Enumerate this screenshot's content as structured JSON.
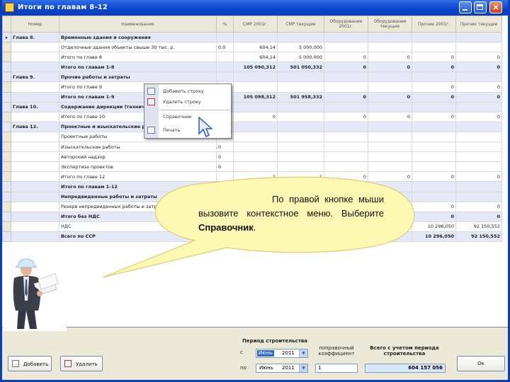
{
  "window": {
    "title": "Итоги по главам 8-12"
  },
  "table": {
    "columns": [
      "Номер",
      "Наименование",
      "%",
      "СМР 2001г.",
      "СМР текущие",
      "Оборудование 2001г.",
      "Оборудование текущие",
      "Прочие 2001г.",
      "Прочие текущие"
    ],
    "rows": [
      {
        "marker": "▸",
        "num": "Глава 8.",
        "name": "Временные здания и сооружения",
        "pct": "",
        "smr2001": "",
        "smrcur": "",
        "eq2001": "",
        "eqcur": "",
        "oth2001": "",
        "othcur": "",
        "style": "blue-bold"
      },
      {
        "marker": "",
        "num": "",
        "name": "Отделочные здания объекты свыше 30 тыс. р.",
        "pct": "0,0",
        "smr2001": "604,14",
        "smrcur": "5 000,000",
        "eq2001": "",
        "eqcur": "",
        "oth2001": "",
        "othcur": "",
        "style": ""
      },
      {
        "marker": "",
        "num": "",
        "name": "Итого по главе 8",
        "pct": "",
        "smr2001": "604,14",
        "smrcur": "5 000,000",
        "eq2001": "0",
        "eqcur": "0",
        "oth2001": "0",
        "othcur": "0",
        "style": ""
      },
      {
        "marker": "",
        "num": "",
        "name": "Итого по главам 1-8",
        "pct": "",
        "smr2001": "105 090,312",
        "smrcur": "501 050,332",
        "eq2001": "0",
        "eqcur": "0",
        "oth2001": "0",
        "othcur": "0",
        "style": "blue-bold"
      },
      {
        "marker": "",
        "num": "Глава 9.",
        "name": "Прочие работы и затраты",
        "pct": "",
        "smr2001": "",
        "smrcur": "",
        "eq2001": "",
        "eqcur": "",
        "oth2001": "",
        "othcur": "",
        "style": "blue-bold"
      },
      {
        "marker": "",
        "num": "",
        "name": "Итого по главе 9",
        "pct": "",
        "smr2001": "",
        "smrcur": "",
        "eq2001": "",
        "eqcur": "",
        "oth2001": "0",
        "othcur": "0",
        "style": ""
      },
      {
        "marker": "",
        "num": "",
        "name": "Итого по главам 1-9",
        "pct": "",
        "smr2001": "105 098,312",
        "smrcur": "501 958,332",
        "eq2001": "0",
        "eqcur": "0",
        "oth2001": "0",
        "othcur": "0",
        "style": "blue-bold"
      },
      {
        "marker": "",
        "num": "Глава 10.",
        "name": "Содержание дирекции (технический надзор)",
        "pct": "",
        "smr2001": "",
        "smrcur": "",
        "eq2001": "",
        "eqcur": "",
        "oth2001": "",
        "othcur": "",
        "style": "blue-bold"
      },
      {
        "marker": "",
        "num": "",
        "name": "Итого по главе 10",
        "pct": "",
        "smr2001": "0",
        "smrcur": "",
        "eq2001": "0",
        "eqcur": "0",
        "oth2001": "0",
        "othcur": "0",
        "style": ""
      },
      {
        "marker": "",
        "num": "Глава 12.",
        "name": "Проектные и изыскательские работы",
        "pct": "",
        "smr2001": "",
        "smrcur": "",
        "eq2001": "",
        "eqcur": "",
        "oth2001": "",
        "othcur": "",
        "style": "blue-bold"
      },
      {
        "marker": "",
        "num": "",
        "name": "Проектные работы",
        "pct": "",
        "smr2001": "",
        "smrcur": "",
        "eq2001": "",
        "eqcur": "",
        "oth2001": "",
        "othcur": "",
        "style": ""
      },
      {
        "marker": "",
        "num": "",
        "name": "Изыскательские работы",
        "pct": "0",
        "smr2001": "",
        "smrcur": "",
        "eq2001": "",
        "eqcur": "",
        "oth2001": "",
        "othcur": "",
        "style": ""
      },
      {
        "marker": "",
        "num": "",
        "name": "Авторский надзор",
        "pct": "0",
        "smr2001": "",
        "smrcur": "",
        "eq2001": "",
        "eqcur": "",
        "oth2001": "",
        "othcur": "",
        "style": ""
      },
      {
        "marker": "",
        "num": "",
        "name": "Экспертиза проектов",
        "pct": "0",
        "smr2001": "",
        "smrcur": "",
        "eq2001": "",
        "eqcur": "",
        "oth2001": "",
        "othcur": "",
        "style": ""
      },
      {
        "marker": "",
        "num": "",
        "name": "Итого по главе 12",
        "pct": "",
        "smr2001": "1",
        "smrcur": "1",
        "eq2001": "0",
        "eqcur": "0",
        "oth2001": "0",
        "othcur": "0",
        "style": ""
      },
      {
        "marker": "",
        "num": "",
        "name": "Итого по главам 1-12",
        "pct": "",
        "smr2001": "",
        "smrcur": "",
        "eq2001": "",
        "eqcur": "",
        "oth2001": "",
        "othcur": "",
        "style": "blue-bold"
      },
      {
        "marker": "",
        "num": "",
        "name": "Непредвиденные работы и затраты",
        "pct": "",
        "smr2001": "",
        "smrcur": "",
        "eq2001": "",
        "eqcur": "",
        "oth2001": "",
        "othcur": "",
        "style": "blue-bold"
      },
      {
        "marker": "",
        "num": "",
        "name": "Резерв непредвиденных работы и затрат",
        "pct": "",
        "smr2001": "",
        "smrcur": "",
        "eq2001": "",
        "eqcur": "",
        "oth2001": "0",
        "othcur": "0",
        "style": ""
      },
      {
        "marker": "",
        "num": "",
        "name": "Итого без НДС",
        "pct": "",
        "smr2001": "",
        "smrcur": "",
        "eq2001": "",
        "eqcur": "",
        "oth2001": "0",
        "othcur": "0",
        "style": "blue-bold"
      },
      {
        "marker": "",
        "num": "",
        "name": "НДС",
        "pct": "",
        "smr2001": "",
        "smrcur": "",
        "eq2001": "",
        "eqcur": "",
        "oth2001": "10 296,050",
        "othcur": "92 150,552",
        "style": ""
      },
      {
        "marker": "",
        "num": "",
        "name": "Всего по ССР",
        "pct": "",
        "smr2001": "",
        "smrcur": "",
        "eq2001": "",
        "eqcur": "",
        "oth2001": "10 296,050",
        "othcur": "92 150,552",
        "style": "blue-bold"
      }
    ]
  },
  "context_menu": {
    "items": [
      {
        "label": "Добавить строку",
        "icon": "add-row-icon"
      },
      {
        "label": "Удалить строку",
        "icon": "delete-row-icon"
      },
      {
        "label": "Справочник",
        "icon": ""
      },
      {
        "label": "Печать",
        "icon": "printer-icon"
      }
    ]
  },
  "hint": {
    "text_line1": "По правой кнопке",
    "text_rest": "мыши вызовите контекстное меню. Выберите ",
    "text_bold": "Справочник",
    "text_end": "."
  },
  "bottom": {
    "add_button": "Добавить",
    "delete_button": "Удалить",
    "period_label": "Период строительства",
    "from_label": "с",
    "to_label": "по",
    "from_month": "Июнь",
    "from_year": "2011",
    "to_month": "Июнь",
    "to_year": "2011",
    "coef_label": "поправочный коэффициент",
    "coef_value": "1",
    "total_label": "Всего с учетом периода строительства",
    "total_value": "604 157 056",
    "ok_button": "Ок"
  },
  "colors": {
    "title_bar": "#0a3fb8",
    "highlight_row": "#e4e8f7",
    "bubble": "#fdf8b4",
    "selection": "#316ac5"
  }
}
